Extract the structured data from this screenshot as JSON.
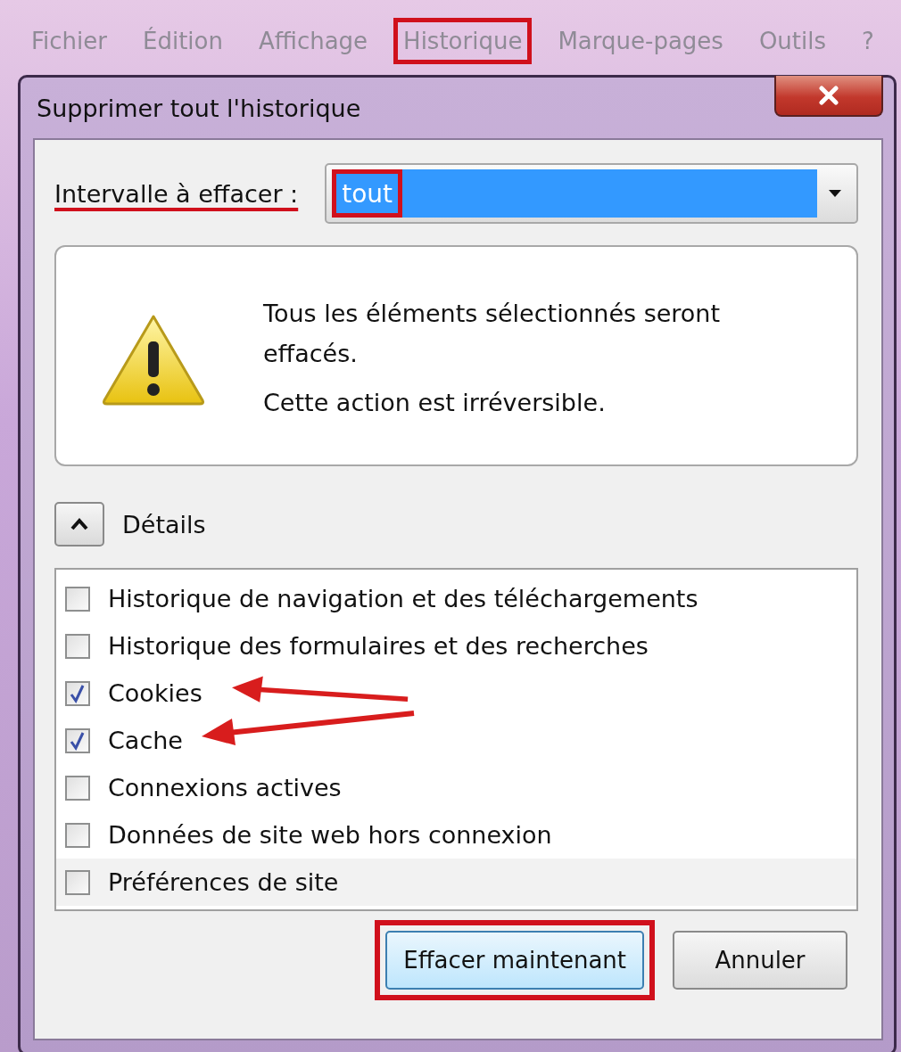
{
  "menu_bar": {
    "items": [
      {
        "label": "Fichier",
        "highlighted": false
      },
      {
        "label": "Édition",
        "highlighted": false
      },
      {
        "label": "Affichage",
        "highlighted": false
      },
      {
        "label": "Historique",
        "highlighted": true
      },
      {
        "label": "Marque-pages",
        "highlighted": false
      },
      {
        "label": "Outils",
        "highlighted": false
      },
      {
        "label": "?",
        "highlighted": false
      }
    ]
  },
  "dialog": {
    "title": "Supprimer tout l'historique",
    "range": {
      "label": "Intervalle à effacer :",
      "label_annotated": true,
      "value": "tout",
      "value_highlighted": true
    },
    "warning": {
      "lines": [
        "Tous les éléments sélectionnés seront effacés.",
        "Cette action est irréversible."
      ]
    },
    "details": {
      "label": "Détails",
      "expanded": true
    },
    "items": [
      {
        "label": "Historique de navigation et des téléchargements",
        "checked": false,
        "arrow": false
      },
      {
        "label": "Historique des formulaires et des recherches",
        "checked": false,
        "arrow": false
      },
      {
        "label": "Cookies",
        "checked": true,
        "arrow": true
      },
      {
        "label": "Cache",
        "checked": true,
        "arrow": true
      },
      {
        "label": "Connexions actives",
        "checked": false,
        "arrow": false
      },
      {
        "label": "Données de site web hors connexion",
        "checked": false,
        "arrow": false
      },
      {
        "label": "Préférences de site",
        "checked": false,
        "arrow": false
      }
    ],
    "buttons": [
      {
        "label": "Effacer maintenant",
        "highlighted": true
      },
      {
        "label": "Annuler",
        "highlighted": false
      }
    ]
  }
}
